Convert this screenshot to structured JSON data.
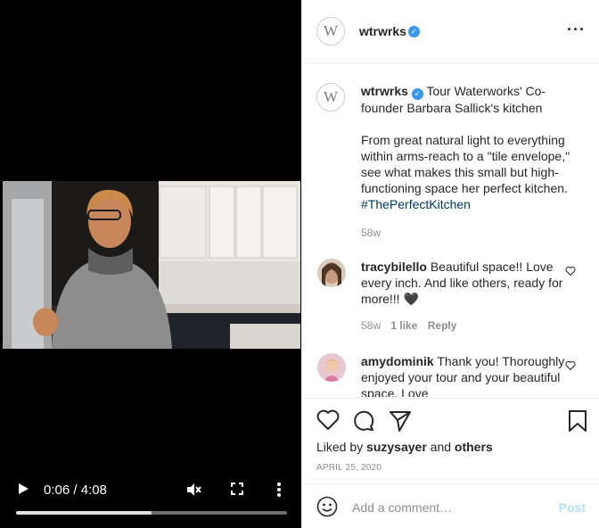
{
  "video": {
    "time_display": "0:06 / 4:08",
    "progress_fraction": 0.5
  },
  "post": {
    "username": "wtrwrks",
    "avatar_letter": "W",
    "caption_title": "Tour Waterworks' Co-founder Barbara Sallick's kitchen",
    "caption_body": "From great natural light to everything within arms-reach to a \"tile envelope,\" see what makes this small but high-functioning space her perfect kitchen.",
    "hashtag": "#ThePerfectKitchen",
    "caption_age": "58w"
  },
  "comments": [
    {
      "username": "tracybilello",
      "text": "Beautiful space!! Love every inch. And like others, ready for more!!! 🖤",
      "age": "58w",
      "likes": "1 like",
      "reply": "Reply"
    },
    {
      "username": "amydominik",
      "text": "Thank you! Thoroughly enjoyed your tour and your beautiful space. Love"
    }
  ],
  "likes": {
    "prefix": "Liked by",
    "user": "suzysayer",
    "and": "and",
    "others": "others"
  },
  "date": "APRIL 25, 2020",
  "add_comment": {
    "placeholder": "Add a comment…",
    "post_label": "Post"
  },
  "colors": {
    "verified": "#3897f0",
    "hashtag": "#00376b",
    "post_disabled": "#b2dffc"
  }
}
